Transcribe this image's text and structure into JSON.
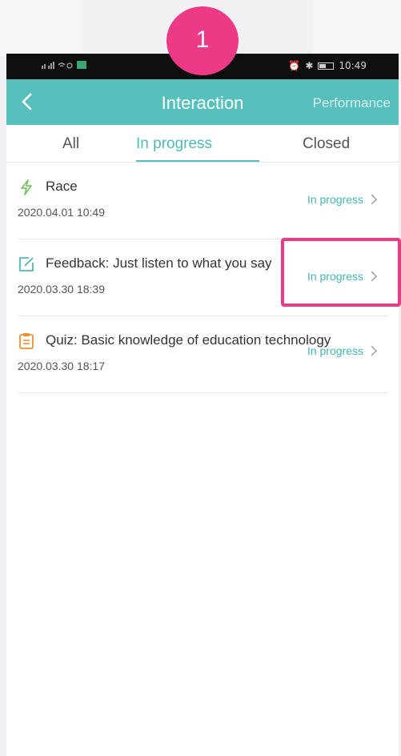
{
  "step_badge": "1",
  "status_bar": {
    "time": "10:49"
  },
  "header": {
    "title": "Interaction",
    "right_link": "Performance",
    "back_icon": "chevron-left-icon"
  },
  "tabs": [
    {
      "label": "All",
      "active": false
    },
    {
      "label": "In progress",
      "active": true
    },
    {
      "label": "Closed",
      "active": false
    }
  ],
  "items": [
    {
      "icon": "lightning-icon",
      "icon_color": "#7cc46a",
      "title": "Race",
      "date": "2020.04.01 10:49",
      "status": "In progress"
    },
    {
      "icon": "edit-icon",
      "icon_color": "#4fbab6",
      "title": "Feedback: Just listen to what you say",
      "date": "2020.03.30 18:39",
      "status": "In progress"
    },
    {
      "icon": "clipboard-icon",
      "icon_color": "#f0902a",
      "title": "Quiz: Basic knowledge of education technology",
      "date": "2020.03.30 18:17",
      "status": "In progress"
    }
  ],
  "colors": {
    "accent": "#57c0bd",
    "highlight": "#ec3a86",
    "status_text": "#44b6b1"
  }
}
